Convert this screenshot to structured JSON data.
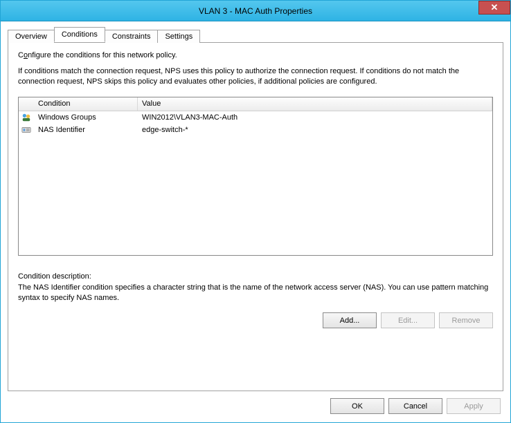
{
  "window": {
    "title": "VLAN 3 - MAC Auth Properties"
  },
  "tabs": {
    "overview": "Overview",
    "conditions": "Conditions",
    "constraints": "Constraints",
    "settings": "Settings"
  },
  "panel": {
    "configure_line_pre": "C",
    "configure_line_accesskey": "o",
    "configure_line_post": "nfigure the conditions for this network policy.",
    "match_text": "If conditions match the connection request, NPS uses this policy to authorize the connection request. If conditions do not match the connection request, NPS skips this policy and evaluates other policies, if additional policies are configured."
  },
  "list": {
    "headers": {
      "condition": "Condition",
      "value": "Value"
    },
    "rows": [
      {
        "icon": "windows-groups-icon",
        "condition": "Windows Groups",
        "value": "WIN2012\\VLAN3-MAC-Auth"
      },
      {
        "icon": "nas-identifier-icon",
        "condition": "NAS Identifier",
        "value": "edge-switch-*"
      }
    ]
  },
  "cond_desc": {
    "label": "Condition description:",
    "text": "The NAS Identifier condition specifies a character string that is the name of the network access server (NAS). You can use pattern matching syntax to specify NAS names."
  },
  "buttons": {
    "add": "Add...",
    "edit": "Edit...",
    "remove": "Remove",
    "ok": "OK",
    "cancel": "Cancel",
    "apply": "Apply"
  }
}
